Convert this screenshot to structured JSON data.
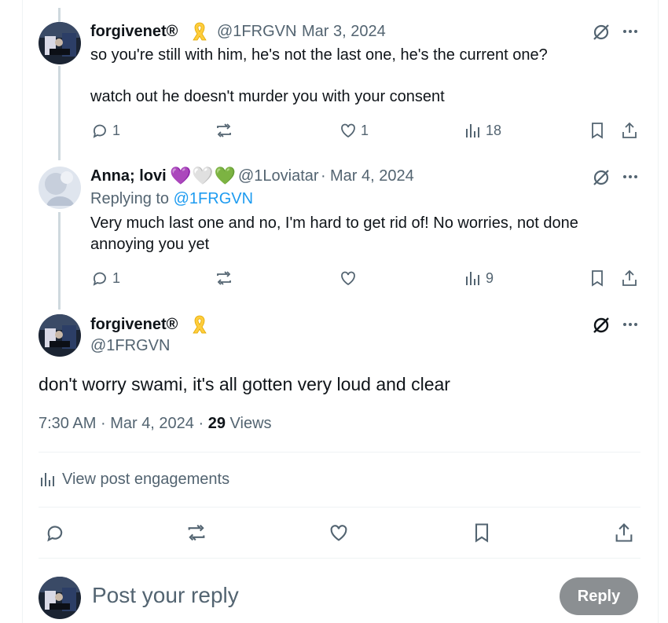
{
  "colors": {
    "link": "#1d9bf0",
    "muted": "#536471",
    "ribbon": "#ffcd3c",
    "reply_button": "#8b8f92"
  },
  "posts": [
    {
      "display_name": "forgivenet®",
      "handle": "@1FRGVN",
      "date": "Mar 3, 2024",
      "text_line1": "so you're still with him, he's not the last one, he's the current one?",
      "text_line2": "watch out he doesn't murder you with your consent",
      "reply_count": "1",
      "like_count": "1",
      "view_count": "18"
    },
    {
      "display_name": "Anna; lovi",
      "hearts": "💜🤍💚",
      "handle": "@1Loviatar",
      "date": "Mar 4, 2024",
      "replying_to_prefix": "Replying to",
      "replying_to_handle": "@1FRGVN",
      "text_line1": "Very much last one and no, I'm hard to get rid of! No worries, not done",
      "text_line2": "annoying you yet",
      "reply_count": "1",
      "view_count": "9"
    }
  ],
  "main_post": {
    "display_name": "forgivenet®",
    "handle": "@1FRGVN",
    "text": "don't worry swami, it's all gotten very loud and clear",
    "time": "7:30 AM",
    "date": "Mar 4, 2024",
    "views_count": "29",
    "views_label": "Views",
    "engagements_label": "View post engagements"
  },
  "compose": {
    "placeholder": "Post your reply",
    "reply_button": "Reply"
  },
  "separator": "·"
}
